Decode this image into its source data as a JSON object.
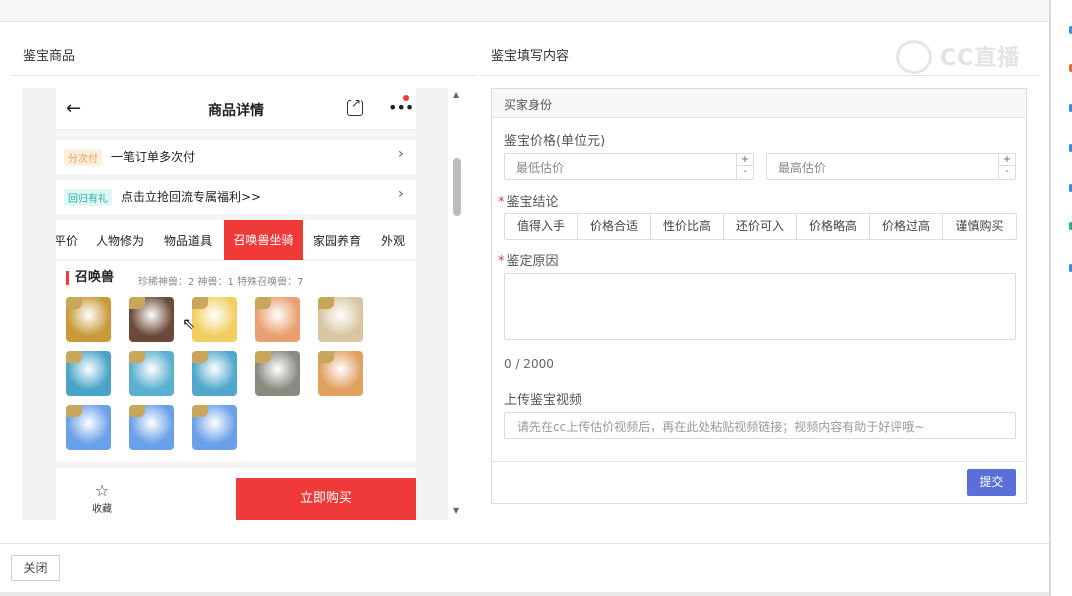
{
  "left_section": {
    "title": "鉴宝商品"
  },
  "right_section": {
    "title": "鉴宝填写内容"
  },
  "watermark": "CC直播",
  "phone": {
    "header": {
      "title": "商品详情",
      "back": "←",
      "more": "•••"
    },
    "rows": [
      {
        "tag": "分次付",
        "text": "一笔订单多次付",
        "tag_color": "#f0a050",
        "tag_bg": "#fdf0e0"
      },
      {
        "tag": "回归有礼",
        "text": "点击立抢回流专属福利>>",
        "tag_color": "#1fb5a8",
        "tag_bg": "#dff6f3"
      }
    ],
    "tabs": [
      "平价",
      "人物修为",
      "物品道具",
      "召唤兽坐骑",
      "家园养育",
      "外观"
    ],
    "active_tab": "召唤兽坐骑",
    "summons": {
      "title": "召唤兽",
      "sub": "珍稀神兽：2   神兽：1   特殊召唤兽：7"
    },
    "pets": [
      {
        "name": "golden-beast-icon",
        "color": "#c89a3a"
      },
      {
        "name": "warrior-pet-icon",
        "color": "#6b4a3a"
      },
      {
        "name": "golden-spirit-icon",
        "color": "#f1cf62"
      },
      {
        "name": "girl-pet-icon",
        "color": "#e8a070"
      },
      {
        "name": "white-dragon-icon",
        "color": "#d8c6a2"
      },
      {
        "name": "fairy-pet-icon",
        "color": "#4aa4c8"
      },
      {
        "name": "fairy-pet-2-icon",
        "color": "#5bb0d0"
      },
      {
        "name": "fairy-pet-3-icon",
        "color": "#52a8cc"
      },
      {
        "name": "stone-beast-icon",
        "color": "#8a8a80"
      },
      {
        "name": "orange-beast-icon",
        "color": "#e0a060"
      },
      {
        "name": "ice-beast-icon",
        "color": "#6aa0e8"
      },
      {
        "name": "ice-beast-2-icon",
        "color": "#6aa0e8"
      },
      {
        "name": "ice-beast-3-icon",
        "color": "#6aa0e8"
      }
    ],
    "bottom": {
      "fav_label": "收藏",
      "buy_label": "立即购买"
    }
  },
  "form": {
    "header": "买家身份",
    "price_label": "鉴宝价格(单位元)",
    "min_placeholder": "最低估价",
    "max_placeholder": "最高估价",
    "conclusion_label": "鉴宝结论",
    "conclusions": [
      "值得入手",
      "价格合适",
      "性价比高",
      "还价可入",
      "价格略高",
      "价格过高",
      "谨慎购买"
    ],
    "reason_label": "鉴定原因",
    "counter": "0 / 2000",
    "video_label": "上传鉴宝视频",
    "video_placeholder": "请先在cc上传估价视频后，再在此处粘贴视频链接；视频内容有助于好评哦~",
    "submit_label": "提交"
  },
  "footer": {
    "close_label": "关闭"
  }
}
